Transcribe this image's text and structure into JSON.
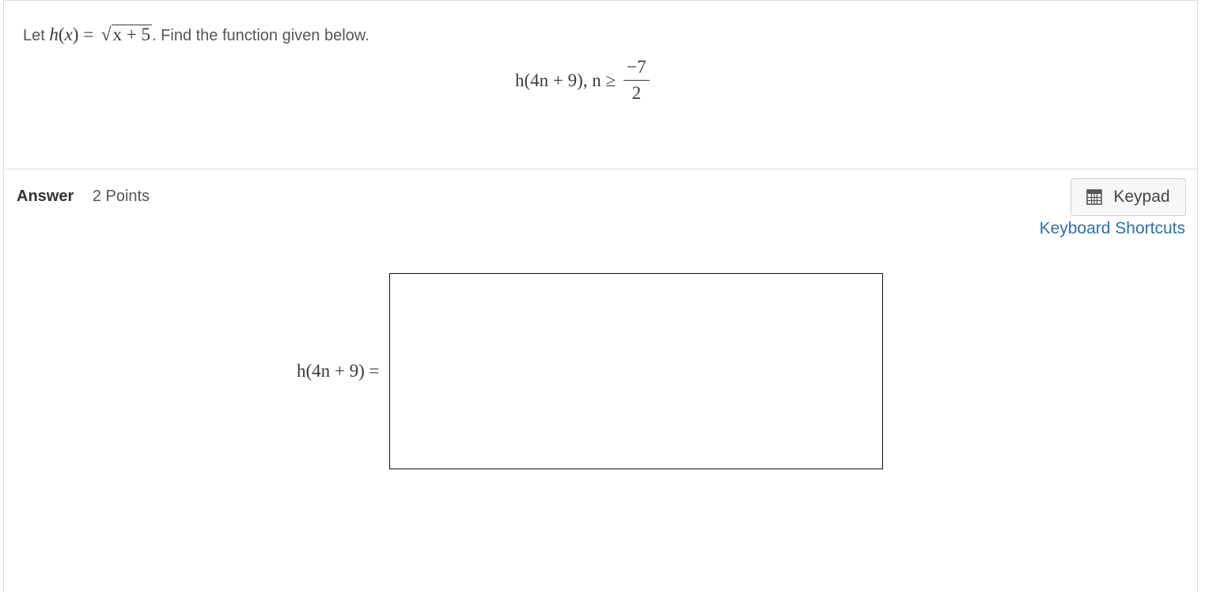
{
  "question": {
    "prompt_prefix": "Let",
    "function_def": {
      "name": "h",
      "var": "x",
      "equals": "=",
      "radicand": "x + 5",
      "period": "."
    },
    "prompt_suffix": "Find the function given below.",
    "display": {
      "expression": "h(4n + 9), n ≥",
      "fraction_numerator": "−7",
      "fraction_denominator": "2"
    }
  },
  "answer": {
    "label": "Answer",
    "points": "2 Points",
    "lhs": "h(4n + 9) =",
    "keypad_label": "Keypad",
    "shortcuts_label": "Keyboard Shortcuts"
  },
  "icons": {
    "keypad": "calculator-icon"
  }
}
